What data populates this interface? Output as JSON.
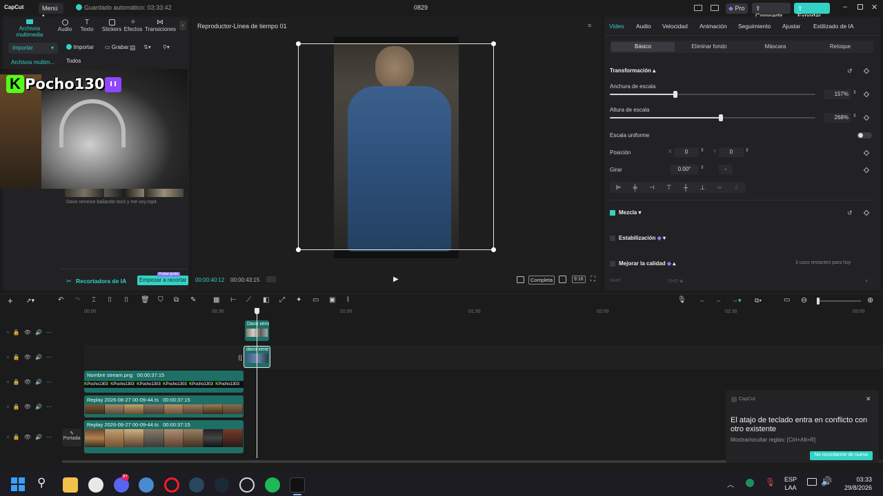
{
  "titlebar": {
    "logo": "CapCut",
    "menu_label": "Menú",
    "autosave": "Guardado automático: 03:33:42",
    "project_name": "0829",
    "pro_label": "Pro",
    "share_label": "Compartir",
    "export_label": "Exportar"
  },
  "left_tabs": [
    {
      "label": "Archivos multimedia",
      "icon": "media-icon"
    },
    {
      "label": "Audio",
      "icon": "audio-icon"
    },
    {
      "label": "Texto",
      "icon": "text-icon"
    },
    {
      "label": "Stickers",
      "icon": "sticker-icon"
    },
    {
      "label": "Efectos",
      "icon": "effects-icon"
    },
    {
      "label": "Transiciones",
      "icon": "transitions-icon"
    }
  ],
  "media": {
    "import_dropdown": "Importar",
    "sidebar_item": "Archivos multim...",
    "import_button": "Importar",
    "record_button": "Grabar",
    "filter_all": "Todos",
    "overlay_name": "Pocho1303",
    "clip_name": "Davo xeneise bailando tocó y me voy.mp4",
    "ai_label": "Recortadora de IA",
    "ai_badge": "Probar gratis",
    "ai_button": "Empezar a recortar"
  },
  "player": {
    "title": "Reproductor-Línea de tiempo 01",
    "current_time": "00:00:40:12",
    "total_time": "00:00:43:15",
    "quality": "Completa",
    "ratio": "9:16"
  },
  "inspector": {
    "tabs": [
      "Video",
      "Audio",
      "Velocidad",
      "Animación",
      "Seguimiento",
      "Ajustar",
      "Estilizado de IA"
    ],
    "subtabs": [
      "Básico",
      "Eliminar fondo",
      "Máscara",
      "Retoque"
    ],
    "section_transform": "Transformación",
    "scale_width_label": "Anchura de escala",
    "scale_width_value": "157%",
    "scale_width_level": 0.32,
    "scale_height_label": "Altura de escala",
    "scale_height_value": "268%",
    "scale_height_level": 0.54,
    "uniform_label": "Escala uniforme",
    "position_label": "Posición",
    "x_label": "X",
    "x_value": "0",
    "y_label": "Y",
    "y_value": "0",
    "rotate_label": "Girar",
    "rotate_value": "0.00°",
    "rotate_extra": "-",
    "blend_label": "Mezcla",
    "stabilize_label": "Estabilización",
    "quality_label": "Mejorar la calidad",
    "quality_uses": "3 usos restantes para hoy",
    "level_label": "Nivel",
    "level_value": "UHD"
  },
  "timeline": {
    "ruler": [
      "00:00",
      "00:30",
      "01:00",
      "01:30",
      "02:00",
      "02:30",
      "03:00"
    ],
    "cover_label": "Portada",
    "clips": [
      {
        "name": "Davo xene",
        "duration": ""
      },
      {
        "name": "davo xene",
        "duration": ""
      },
      {
        "name": "Nombre stream.png",
        "duration": "00:00:37:15"
      },
      {
        "name": "Replay 2026-08-27 00-09-44.ts",
        "duration": "00:00:37:15"
      },
      {
        "name": "Replay 2026-08-27 00-09-44.ts",
        "duration": "00:00:37:15"
      }
    ],
    "stream_logo_text": "Pocho1303"
  },
  "toast": {
    "app": "CapCut",
    "message": "El atajo de teclado entra en conflicto con otro existente",
    "hint": "Mostrar/ocultar reglas: [Ctrl+Alt+R]",
    "button": "No recordarme de nuevo"
  },
  "taskbar": {
    "lang_top": "ESP",
    "lang_bottom": "LAA",
    "time": "03:33",
    "date": "29/8/2026",
    "discord_badge": "9+"
  },
  "colors": {
    "accent": "#33d1c6",
    "pro": "#8a7cf0",
    "background": "#1b1b1b"
  }
}
